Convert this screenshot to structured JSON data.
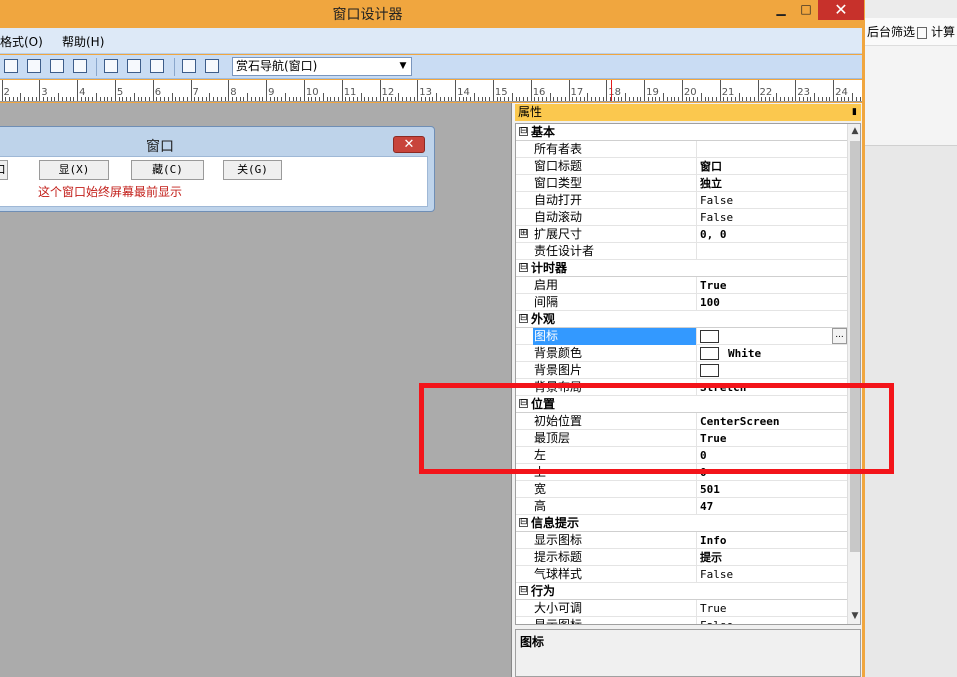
{
  "window": {
    "title": "窗口设计器",
    "minimize_glyph": "▁",
    "maximize_glyph": "□",
    "close_glyph": "✕"
  },
  "background_app": {
    "filter_label": "后台筛选",
    "calc_label": "计算"
  },
  "menubar": {
    "items": [
      {
        "label": "格式(O)"
      },
      {
        "label": "帮助(H)"
      }
    ]
  },
  "toolbar": {
    "combo_value": "赏石导航(窗口)"
  },
  "ruler": {
    "labels": [
      "2",
      "3",
      "4",
      "5",
      "6",
      "7",
      "8",
      "9",
      "10",
      "11",
      "12",
      "13",
      "14",
      "15",
      "16",
      "17",
      "18",
      "19",
      "20",
      "21",
      "22",
      "23",
      "24"
    ]
  },
  "preview_window": {
    "title": "窗口",
    "close_glyph": "✕",
    "buttons": [
      "口",
      "显(X)",
      "藏(C)",
      "关(G)"
    ],
    "note": "这个窗口始终屏幕最前显示"
  },
  "properties": {
    "header": "属性",
    "pin_glyph": "▮",
    "rows": [
      {
        "kind": "cat",
        "exp": "⊟",
        "label": "基本"
      },
      {
        "label": "所有者表",
        "value": ""
      },
      {
        "label": "窗口标题",
        "value": "窗口",
        "bold": true
      },
      {
        "label": "窗口类型",
        "value": "独立",
        "bold": true
      },
      {
        "label": "自动打开",
        "value": "False"
      },
      {
        "label": "自动滚动",
        "value": "False"
      },
      {
        "label": "扩展尺寸",
        "value": "0, 0",
        "bold": true,
        "exp": "⊞"
      },
      {
        "label": "责任设计者",
        "value": ""
      },
      {
        "kind": "cat",
        "exp": "⊟",
        "label": "计时器"
      },
      {
        "label": "启用",
        "value": "True",
        "bold": true
      },
      {
        "label": "间隔",
        "value": "100",
        "bold": true
      },
      {
        "kind": "cat",
        "exp": "⊟",
        "label": "外观"
      },
      {
        "label": "图标",
        "value": "",
        "swatch": true,
        "selected": true,
        "ellipsis": "..."
      },
      {
        "label": "背景颜色",
        "value": "White",
        "swatch": true,
        "bold": true
      },
      {
        "label": "背景图片",
        "value": "",
        "swatch": true
      },
      {
        "label": "背景布局",
        "value": "Stretch",
        "bold": true
      },
      {
        "kind": "cat",
        "exp": "⊟",
        "label": "位置"
      },
      {
        "label": "初始位置",
        "value": "CenterScreen",
        "bold": true
      },
      {
        "label": "最顶层",
        "value": "True",
        "bold": true
      },
      {
        "label": "左",
        "value": "0",
        "bold": true
      },
      {
        "label": "上",
        "value": "0",
        "bold": true
      },
      {
        "label": "宽",
        "value": "501",
        "bold": true
      },
      {
        "label": "高",
        "value": "47",
        "bold": true
      },
      {
        "kind": "cat",
        "exp": "⊟",
        "label": "信息提示"
      },
      {
        "label": "显示图标",
        "value": "Info",
        "bold": true
      },
      {
        "label": "提示标题",
        "value": "提示",
        "bold": true
      },
      {
        "label": "气球样式",
        "value": "False"
      },
      {
        "kind": "cat",
        "exp": "⊟",
        "label": "行为"
      },
      {
        "label": "大小可调",
        "value": "True"
      },
      {
        "label": "显示图标",
        "value": "False"
      }
    ],
    "scroll_up": "▲",
    "scroll_down": "▼",
    "description_title": "图标"
  }
}
